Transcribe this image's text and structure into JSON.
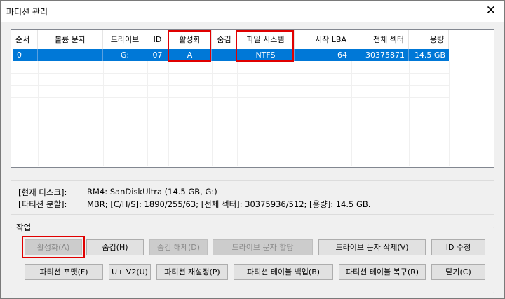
{
  "window": {
    "title": "파티션 관리",
    "close_glyph": "✕"
  },
  "list": {
    "columns": [
      "순서",
      "볼륨 문자",
      "드라이브",
      "ID",
      "활성화",
      "숨김",
      "파일 시스템",
      "시작 LBA",
      "전체 섹터",
      "용량"
    ],
    "rows": [
      [
        "0",
        "",
        "G:",
        "07",
        "A",
        "",
        "NTFS",
        "64",
        "30375871",
        "14.5 GB"
      ]
    ]
  },
  "info": {
    "disk_label": "[현재 디스크]:",
    "disk_value": "RM4: SanDiskUltra (14.5 GB, G:)",
    "partition_label": "[파티션 분할]:",
    "partition_value": "MBR; [C/H/S]: 1890/255/63; [전체 섹터]: 30375936/512; [용량]: 14.5 GB."
  },
  "actions": {
    "group_label": "작업",
    "activate": "활성화(A)",
    "hide": "숨김(H)",
    "unhide": "숨김 해제(D)",
    "assign_letter": "드라이브 문자 할당",
    "delete_letter": "드라이브 문자 삭제(V)",
    "edit_id": "ID 수정",
    "format": "파티션 포맷(F)",
    "u_v2": "U+ V2(U)",
    "reset": "파티션 재설정(P)",
    "backup": "파티션 테이블 백업(B)",
    "restore": "파티션 테이블 복구(R)",
    "close": "닫기(C)"
  },
  "colors": {
    "selection": "#0078d7",
    "highlight_box": "#e00000"
  }
}
